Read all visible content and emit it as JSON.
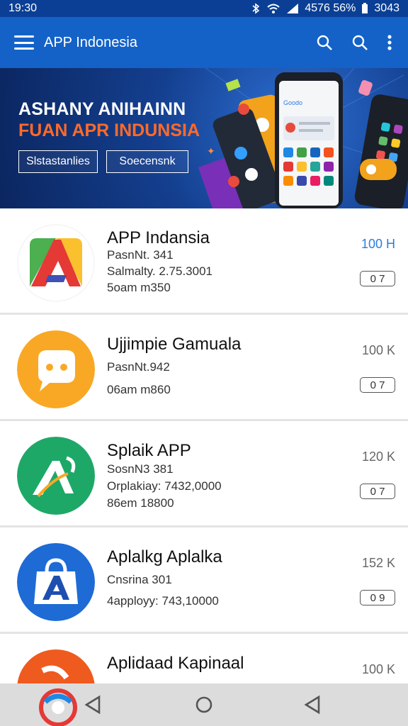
{
  "status_bar": {
    "time": "19:30",
    "battery_text": "4576 56%",
    "right_time": "3043"
  },
  "app_bar": {
    "title": "APP Indonesia"
  },
  "banner": {
    "line1": "ASHANY ANIHAINN",
    "line2": "FUAN APR INDUNSIA",
    "button1": "Slstastanlies",
    "button2": "Soecensnk",
    "phone_app_label": "Goodo"
  },
  "apps": [
    {
      "name": "APP Indansia",
      "line1": "PasnNt. 341",
      "line2": "Salmalty. 2.75.3001",
      "line3": "5oam  m350",
      "size": "100 H",
      "badge": "0 7",
      "size_color": "#2a7de0"
    },
    {
      "name": "Ujjimpie Gamuala",
      "line1": "PasnNt.942",
      "line2": "",
      "line3": "06am  m860",
      "size": "100 K",
      "badge": "0 7",
      "size_color": "#666666"
    },
    {
      "name": "Splaik APP",
      "line1": "SosnN3 381",
      "line2": "Orplakiay: 7432,0000",
      "line3": "86em  18800",
      "size": "120 K",
      "badge": "0 7",
      "size_color": "#666666"
    },
    {
      "name": "Aplalkg Aplalka",
      "line1": "Cnsrina 301",
      "line2": "4apployy: 743,10000",
      "line3": "",
      "size": "152 K",
      "badge": "0 9",
      "size_color": "#666666"
    },
    {
      "name": "Aplidaad Kapinaal",
      "line1": "",
      "line2": "",
      "line3": "",
      "size": "100 K",
      "badge": "",
      "size_color": "#666666"
    }
  ],
  "icons": {
    "menu": "hamburger-menu-icon",
    "search1": "search-icon",
    "search2": "search-icon",
    "more": "more-vert-icon",
    "nav_back": "back-triangle-icon",
    "nav_home": "home-circle-icon",
    "nav_recent": "back-triangle-icon"
  },
  "colors": {
    "status_bar": "#0a3f95",
    "app_bar": "#1462c7",
    "accent_orange": "#ff6a2a",
    "size_blue": "#2a7de0"
  }
}
